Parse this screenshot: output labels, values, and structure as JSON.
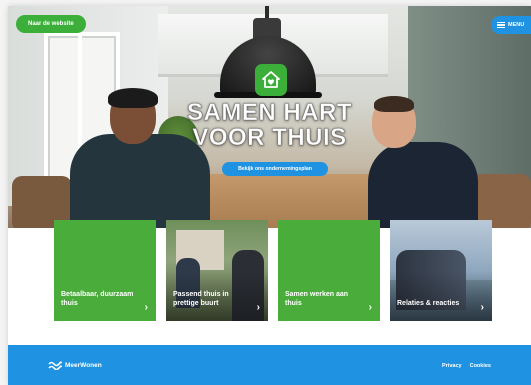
{
  "header": {
    "website_button": "Naar de website",
    "menu_label": "MENU"
  },
  "hero": {
    "headline_line1": "SAMEN HART",
    "headline_line2": "VOOR THUIS",
    "cta_label": "Bekijk ons ondernemingsplan"
  },
  "cards": [
    {
      "label": "Betaalbaar, duurzaam thuis",
      "arrow": "›"
    },
    {
      "label": "Passend thuis in prettige buurt",
      "arrow": "›"
    },
    {
      "label": "Samen werken aan thuis",
      "arrow": "›"
    },
    {
      "label": "Relaties & reacties",
      "arrow": "›"
    }
  ],
  "footer": {
    "brand": "MeerWonen",
    "links": [
      "Privacy",
      "Cookies"
    ]
  },
  "colors": {
    "brand_green": "#4aad3b",
    "brand_blue": "#1f93e1"
  },
  "icons": [
    "heart-house-icon",
    "hamburger-icon",
    "chevron-right-icon",
    "meerwonen-wave-icon"
  ]
}
